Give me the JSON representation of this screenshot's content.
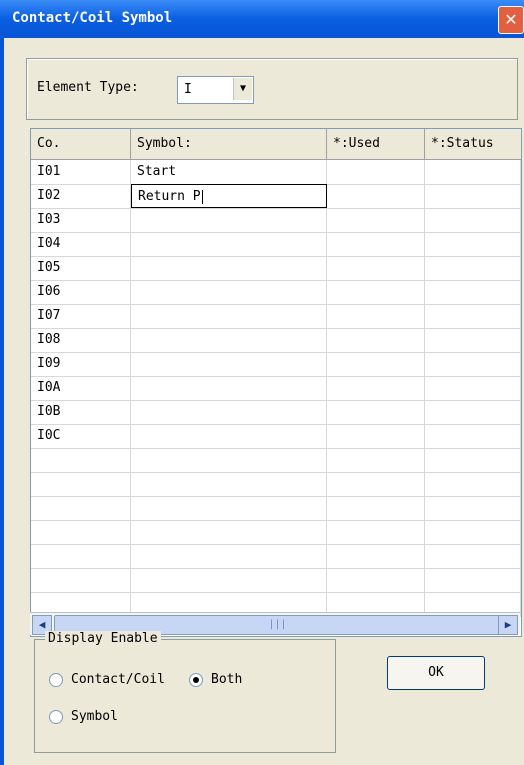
{
  "window": {
    "title": "Contact/Coil Symbol",
    "close_glyph": "✕"
  },
  "element_type": {
    "label": "Element Type:",
    "selected": "I",
    "arrow_glyph": "▼"
  },
  "table": {
    "headers": [
      "Co.",
      "Symbol:",
      "*:Used",
      "*:Status"
    ],
    "rows": [
      {
        "code": "I01",
        "symbol": "Start"
      },
      {
        "code": "I02",
        "symbol": "Return P"
      },
      {
        "code": "I03",
        "symbol": ""
      },
      {
        "code": "I04",
        "symbol": ""
      },
      {
        "code": "I05",
        "symbol": ""
      },
      {
        "code": "I06",
        "symbol": ""
      },
      {
        "code": "I07",
        "symbol": ""
      },
      {
        "code": "I08",
        "symbol": ""
      },
      {
        "code": "I09",
        "symbol": ""
      },
      {
        "code": "I0A",
        "symbol": ""
      },
      {
        "code": "I0B",
        "symbol": ""
      },
      {
        "code": "I0C",
        "symbol": ""
      },
      {
        "code": "",
        "symbol": ""
      },
      {
        "code": "",
        "symbol": ""
      },
      {
        "code": "",
        "symbol": ""
      },
      {
        "code": "",
        "symbol": ""
      },
      {
        "code": "",
        "symbol": ""
      },
      {
        "code": "",
        "symbol": ""
      },
      {
        "code": "",
        "symbol": ""
      }
    ],
    "editing_row": 1,
    "scroll_left_glyph": "◀",
    "scroll_right_glyph": "▶",
    "thumb_grip": "|||"
  },
  "display_enable": {
    "legend": "Display Enable",
    "options": [
      {
        "label": "Contact/Coil",
        "checked": false
      },
      {
        "label": "Both",
        "checked": true
      },
      {
        "label": "Symbol",
        "checked": false
      }
    ]
  },
  "ok_label": "OK"
}
